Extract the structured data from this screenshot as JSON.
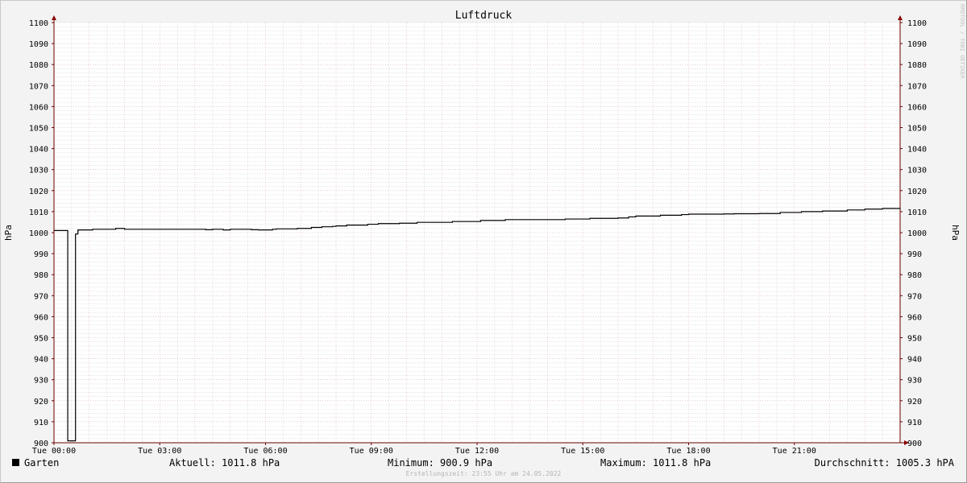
{
  "chart_data": {
    "type": "line",
    "title": "Luftdruck",
    "ylabel": "hPa",
    "ylabel_right": "hPa",
    "ylim": [
      900,
      1100
    ],
    "yticks": [
      900,
      910,
      920,
      930,
      940,
      950,
      960,
      970,
      980,
      990,
      1000,
      1010,
      1020,
      1030,
      1040,
      1050,
      1060,
      1070,
      1080,
      1090,
      1100
    ],
    "xlim": [
      0,
      24
    ],
    "xticks": [
      {
        "x": 0,
        "label": "Tue 00:00"
      },
      {
        "x": 3,
        "label": "Tue 03:00"
      },
      {
        "x": 6,
        "label": "Tue 06:00"
      },
      {
        "x": 9,
        "label": "Tue 09:00"
      },
      {
        "x": 12,
        "label": "Tue 12:00"
      },
      {
        "x": 15,
        "label": "Tue 15:00"
      },
      {
        "x": 18,
        "label": "Tue 18:00"
      },
      {
        "x": 21,
        "label": "Tue 21:00"
      }
    ],
    "grid": true,
    "series": [
      {
        "name": "Garten",
        "color": "#000000",
        "step": true,
        "points": [
          [
            0,
            1001.0
          ],
          [
            0.38,
            1001.0
          ],
          [
            0.39,
            900.9
          ],
          [
            0.6,
            900.9
          ],
          [
            0.61,
            999.3
          ],
          [
            0.66,
            999.5
          ],
          [
            0.68,
            1001.3
          ],
          [
            1.1,
            1001.6
          ],
          [
            1.75,
            1002.0
          ],
          [
            2.0,
            1001.6
          ],
          [
            3.5,
            1001.6
          ],
          [
            4.3,
            1001.4
          ],
          [
            4.5,
            1001.6
          ],
          [
            4.8,
            1001.3
          ],
          [
            5.0,
            1001.6
          ],
          [
            5.5,
            1001.6
          ],
          [
            5.6,
            1001.4
          ],
          [
            5.8,
            1001.3
          ],
          [
            6.2,
            1001.6
          ],
          [
            6.3,
            1001.8
          ],
          [
            6.9,
            1002.0
          ],
          [
            7.3,
            1002.5
          ],
          [
            7.6,
            1002.8
          ],
          [
            7.9,
            1003.0
          ],
          [
            8.0,
            1003.2
          ],
          [
            8.3,
            1003.6
          ],
          [
            8.6,
            1003.6
          ],
          [
            8.9,
            1004.0
          ],
          [
            9.2,
            1004.3
          ],
          [
            9.8,
            1004.5
          ],
          [
            10.3,
            1004.9
          ],
          [
            11.3,
            1005.3
          ],
          [
            12.1,
            1005.8
          ],
          [
            12.8,
            1006.2
          ],
          [
            14.0,
            1006.2
          ],
          [
            14.5,
            1006.5
          ],
          [
            15.2,
            1006.8
          ],
          [
            16.0,
            1007.0
          ],
          [
            16.3,
            1007.5
          ],
          [
            16.5,
            1007.9
          ],
          [
            17.2,
            1008.3
          ],
          [
            17.8,
            1008.6
          ],
          [
            18.0,
            1008.8
          ],
          [
            19.0,
            1008.9
          ],
          [
            19.3,
            1009.0
          ],
          [
            20.0,
            1009.1
          ],
          [
            20.6,
            1009.6
          ],
          [
            21.2,
            1010.0
          ],
          [
            21.8,
            1010.3
          ],
          [
            22.5,
            1010.8
          ],
          [
            23.0,
            1011.2
          ],
          [
            23.5,
            1011.5
          ],
          [
            24.0,
            1011.8
          ]
        ]
      }
    ]
  },
  "legend": {
    "series_name": "Garten",
    "current": "Aktuell: 1011.8 hPa",
    "minimum": "Minimum: 900.9 hPa",
    "maximum": "Maximum: 1011.8 hPa",
    "average": "Durchschnitt: 1005.3 hPA"
  },
  "footer": "Erstellungszeit: 23:55 Uhr am 24.05.2022",
  "watermark": "RRDTOOL / TOBI OETIKER"
}
